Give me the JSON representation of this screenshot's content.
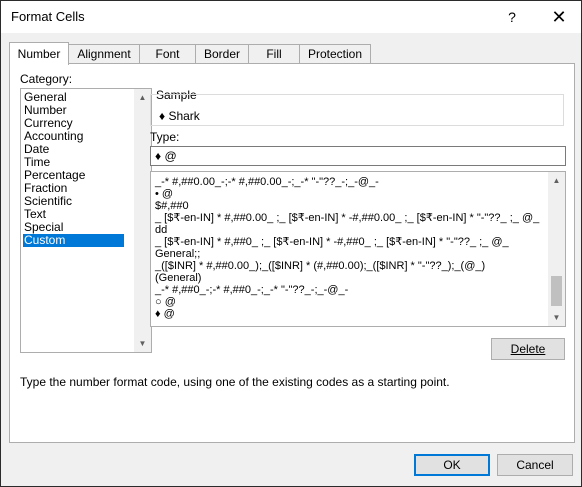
{
  "window": {
    "title": "Format Cells",
    "help_label": "?",
    "close_label": "✕"
  },
  "tabs": [
    {
      "label": "Number",
      "active": true
    },
    {
      "label": "Alignment",
      "active": false
    },
    {
      "label": "Font",
      "active": false
    },
    {
      "label": "Border",
      "active": false
    },
    {
      "label": "Fill",
      "active": false
    },
    {
      "label": "Protection",
      "active": false
    }
  ],
  "category": {
    "label": "Category:",
    "items": [
      "General",
      "Number",
      "Currency",
      "Accounting",
      "Date",
      "Time",
      "Percentage",
      "Fraction",
      "Scientific",
      "Text",
      "Special",
      "Custom"
    ],
    "selected": "Custom"
  },
  "sample": {
    "label": "Sample",
    "value": "♦ Shark"
  },
  "type": {
    "label": "Type:",
    "value": "♦ @",
    "formats": [
      "_-* #,##0.00_-;-* #,##0.00_-;_-* \"-\"??_-;_-@_-",
      "• @",
      "$#,##0",
      "_ [$₹-en-IN] * #,##0.00_ ;_ [$₹-en-IN] * -#,##0.00_ ;_ [$₹-en-IN] * \"-\"??_ ;_ @_",
      "dd",
      "_ [$₹-en-IN] * #,##0_ ;_ [$₹-en-IN] * -#,##0_ ;_ [$₹-en-IN] * \"-\"??_ ;_ @_",
      "General;;",
      "_([$INR] * #,##0.00_);_([$INR] * (#,##0.00);_([$INR] * \"-\"??_);_(@_)",
      "(General)",
      "_-* #,##0_-;-* #,##0_-;_-* \"-\"??_-;_-@_-",
      "○ @",
      "♦ @"
    ]
  },
  "buttons": {
    "delete": "Delete",
    "ok": "OK",
    "cancel": "Cancel"
  },
  "hint": "Type the number format code, using one of the existing codes as a starting point."
}
